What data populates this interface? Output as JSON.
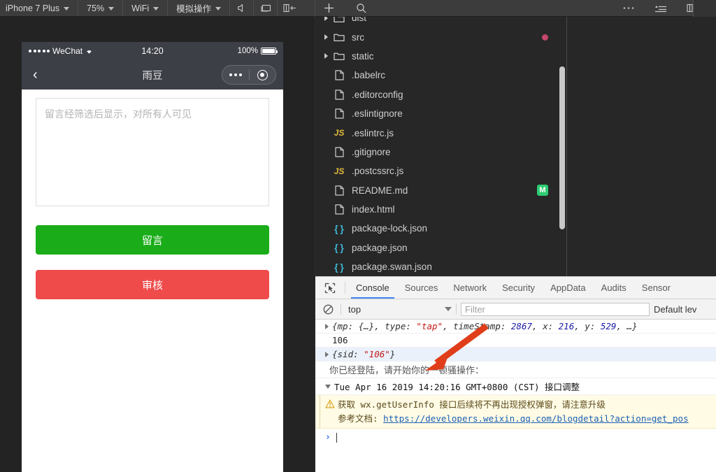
{
  "toolbar": {
    "device": "iPhone 7 Plus",
    "zoom": "75%",
    "network": "WiFi",
    "simulate": "模拟操作",
    "icons": {
      "mute": "speaker-mute-icon",
      "screen": "screen-icon",
      "panel_right": "panel-toggle-right-icon",
      "add": "plus-icon",
      "search": "search-icon",
      "more": "more-horizontal-icon",
      "list": "list-icon",
      "panel_left": "panel-toggle-left-icon"
    }
  },
  "simulator": {
    "status_bar": {
      "carrier": "WeChat",
      "time": "14:20",
      "battery_percent": "100%"
    },
    "nav": {
      "title": "雨豆",
      "back_icon": "chevron-left-icon",
      "more_icon": "more-dots-icon",
      "target_icon": "target-circle-icon"
    },
    "page": {
      "textarea_placeholder": "留言经筛选后显示，对所有人可见",
      "textarea_value": "",
      "primary_button": "留言",
      "danger_button": "审核",
      "primary_color": "#1aad19",
      "danger_color": "#ef4b4b"
    }
  },
  "file_tree": {
    "items": [
      {
        "label": "dist",
        "type": "folder",
        "expandable": true,
        "icon": "folder-icon",
        "badge": null,
        "partial": true
      },
      {
        "label": "src",
        "type": "folder",
        "expandable": true,
        "icon": "folder-icon",
        "badge": "dot"
      },
      {
        "label": "static",
        "type": "folder",
        "expandable": true,
        "icon": "folder-icon",
        "badge": null
      },
      {
        "label": ".babelrc",
        "type": "file",
        "expandable": false,
        "icon": "file-icon",
        "badge": null
      },
      {
        "label": ".editorconfig",
        "type": "file",
        "expandable": false,
        "icon": "file-icon",
        "badge": null
      },
      {
        "label": ".eslintignore",
        "type": "file",
        "expandable": false,
        "icon": "file-icon",
        "badge": null
      },
      {
        "label": ".eslintrc.js",
        "type": "file",
        "expandable": false,
        "icon": "js-icon",
        "badge": null
      },
      {
        "label": ".gitignore",
        "type": "file",
        "expandable": false,
        "icon": "file-icon",
        "badge": null
      },
      {
        "label": ".postcssrc.js",
        "type": "file",
        "expandable": false,
        "icon": "js-icon",
        "badge": null
      },
      {
        "label": "README.md",
        "type": "file",
        "expandable": false,
        "icon": "file-icon",
        "badge": "M"
      },
      {
        "label": "index.html",
        "type": "file",
        "expandable": false,
        "icon": "file-icon",
        "badge": null
      },
      {
        "label": "package-lock.json",
        "type": "file",
        "expandable": false,
        "icon": "json-icon",
        "badge": null
      },
      {
        "label": "package.json",
        "type": "file",
        "expandable": false,
        "icon": "json-icon",
        "badge": null
      },
      {
        "label": "package.swan.json",
        "type": "file",
        "expandable": false,
        "icon": "json-icon",
        "badge": null
      }
    ],
    "badge_colors": {
      "modified": "#2ecc71",
      "dot": "#c4476b"
    }
  },
  "devtools": {
    "inspect_icon": "inspect-cursor-icon",
    "tabs": [
      {
        "label": "Console",
        "active": true
      },
      {
        "label": "Sources",
        "active": false
      },
      {
        "label": "Network",
        "active": false
      },
      {
        "label": "Security",
        "active": false
      },
      {
        "label": "AppData",
        "active": false
      },
      {
        "label": "Audits",
        "active": false
      },
      {
        "label": "Sensor",
        "active": false
      }
    ],
    "active_tab_color": "#4285f4",
    "console_toolbar": {
      "clear_icon": "clear-console-icon",
      "context": "top",
      "filter_placeholder": "Filter",
      "filter_value": "",
      "level": "Default lev"
    },
    "console_lines": [
      {
        "kind": "object",
        "expandable": true,
        "selected": false,
        "parts": [
          {
            "t": "{mp: {…}, type: ",
            "c": "plain"
          },
          {
            "t": "\"tap\"",
            "c": "string"
          },
          {
            "t": ", timeStamp: ",
            "c": "plain"
          },
          {
            "t": "2867",
            "c": "number"
          },
          {
            "t": ", x: ",
            "c": "plain"
          },
          {
            "t": "216",
            "c": "number"
          },
          {
            "t": ", y: ",
            "c": "plain"
          },
          {
            "t": "529",
            "c": "number"
          },
          {
            "t": ", …}",
            "c": "plain"
          }
        ]
      },
      {
        "kind": "plain",
        "expandable": false,
        "selected": false,
        "text": "106"
      },
      {
        "kind": "object",
        "expandable": true,
        "selected": true,
        "parts": [
          {
            "t": "{sid: ",
            "c": "plain"
          },
          {
            "t": "\"106\"",
            "c": "string"
          },
          {
            "t": "}",
            "c": "plain"
          }
        ]
      },
      {
        "kind": "cn",
        "expandable": false,
        "selected": false,
        "text": "你已经登陆，请开始你的一顿骚操作："
      },
      {
        "kind": "timestamp",
        "expandable": true,
        "expanded": true,
        "selected": false,
        "text": "Tue Apr 16 2019 14:20:16 GMT+0800 (CST) 接口调整"
      }
    ],
    "warning": {
      "icon": "warning-triangle-icon",
      "line1": "获取 wx.getUserInfo 接口后续将不再出现授权弹窗，请注意升级",
      "line2_label": "参考文档: ",
      "line2_link": "https://developers.weixin.qq.com/blogdetail?action=get_pos"
    },
    "prompt": {
      "chevron": "›",
      "value": ""
    }
  },
  "annotation": {
    "arrow_color": "#e03e1a",
    "name": "red-arrow-pointing-to-sid-log"
  }
}
